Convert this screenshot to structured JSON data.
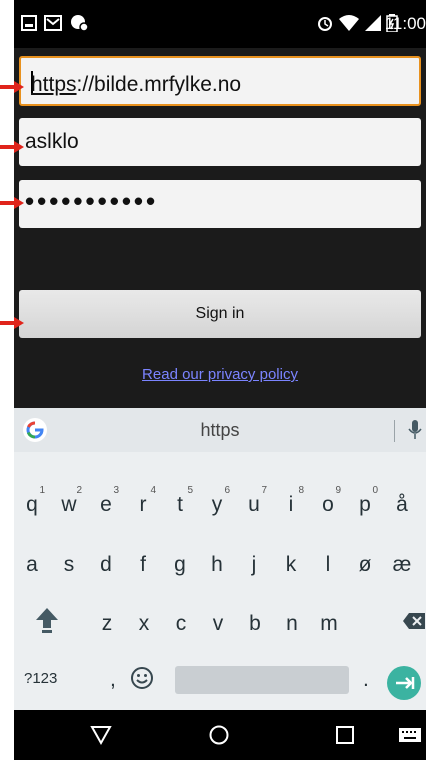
{
  "status_bar": {
    "time": "11:00"
  },
  "form": {
    "url_prefix": "https",
    "url_rest": "://bilde.mrfylke.no",
    "username": "aslklo",
    "password_mask": "•••••••••••",
    "signin_label": "Sign in",
    "privacy_link": "Read our privacy policy"
  },
  "keyboard": {
    "suggestion": "https",
    "row1": [
      {
        "k": "q",
        "h": "1"
      },
      {
        "k": "w",
        "h": "2"
      },
      {
        "k": "e",
        "h": "3"
      },
      {
        "k": "r",
        "h": "4"
      },
      {
        "k": "t",
        "h": "5"
      },
      {
        "k": "y",
        "h": "6"
      },
      {
        "k": "u",
        "h": "7"
      },
      {
        "k": "i",
        "h": "8"
      },
      {
        "k": "o",
        "h": "9"
      },
      {
        "k": "p",
        "h": "0"
      },
      {
        "k": "å",
        "h": ""
      }
    ],
    "row2": [
      "a",
      "s",
      "d",
      "f",
      "g",
      "h",
      "j",
      "k",
      "l",
      "ø",
      "æ"
    ],
    "row3": [
      "z",
      "x",
      "c",
      "v",
      "b",
      "n",
      "m"
    ],
    "symbols_label": "?123",
    "comma": ",",
    "period": "."
  },
  "colors": {
    "field_focus": "#e8911e",
    "link": "#7b84ff",
    "enter_key": "#3bb3a1",
    "annotation_arrow": "#e0241b"
  }
}
